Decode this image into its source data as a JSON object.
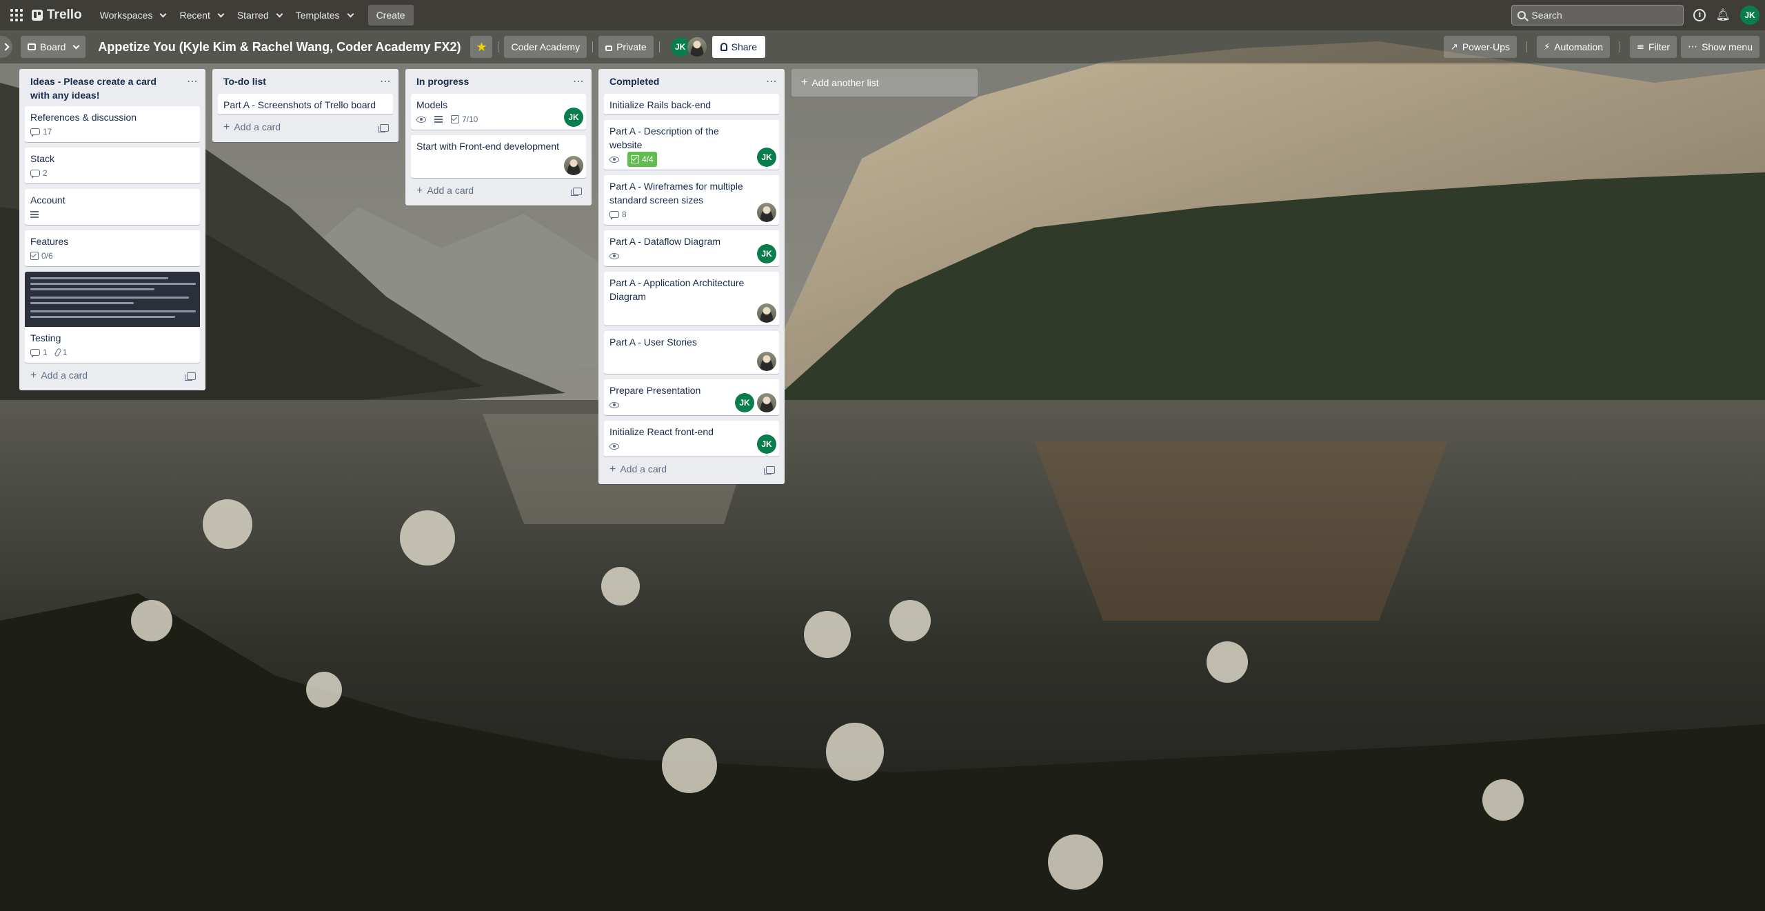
{
  "topnav": {
    "logo_text": "Trello",
    "menus": [
      "Workspaces",
      "Recent",
      "Starred",
      "Templates"
    ],
    "create_label": "Create",
    "search_placeholder": "Search",
    "user_initials": "JK"
  },
  "board": {
    "view_label": "Board",
    "title": "Appetize You (Kyle Kim & Rachel Wang, Coder Academy FX2)",
    "workspace_label": "Coder Academy",
    "visibility_label": "Private",
    "share_label": "Share",
    "powerups_label": "Power-Ups",
    "automation_label": "Automation",
    "filter_label": "Filter",
    "show_menu_label": "Show menu"
  },
  "colors": {
    "accent_green": "#0a7d4c",
    "done_green": "#61bd4f",
    "star_yellow": "#f2d600",
    "list_bg": "#ebecf0"
  },
  "lists": [
    {
      "title": "Ideas - Please create a card with any ideas!",
      "cards": [
        {
          "title": "References & discussion",
          "comments": "17"
        },
        {
          "title": "Stack",
          "comments": "2"
        },
        {
          "title": "Account",
          "has_description": true
        },
        {
          "title": "Features",
          "checklist": "0/6"
        },
        {
          "title": "Testing",
          "comments": "1",
          "attachments": "1",
          "has_cover": true
        }
      ],
      "add_card_label": "Add a card"
    },
    {
      "title": "To-do list",
      "cards": [
        {
          "title": "Part A - Screenshots of Trello board"
        }
      ],
      "add_card_label": "Add a card"
    },
    {
      "title": "In progress",
      "cards": [
        {
          "title": "Models",
          "watching": true,
          "has_description": true,
          "checklist": "7/10",
          "members": [
            "JK"
          ]
        },
        {
          "title": "Start with Front-end development",
          "members": [
            "photo"
          ]
        }
      ],
      "add_card_label": "Add a card"
    },
    {
      "title": "Completed",
      "cards": [
        {
          "title": "Initialize Rails back-end"
        },
        {
          "title": "Part A - Description of the website",
          "watching": true,
          "checklist_done": "4/4",
          "members": [
            "JK"
          ]
        },
        {
          "title": "Part A - Wireframes for multiple standard screen sizes",
          "comments": "8",
          "members": [
            "photo"
          ]
        },
        {
          "title": "Part A - Dataflow Diagram",
          "watching": true,
          "members": [
            "JK"
          ]
        },
        {
          "title": "Part A - Application Architecture Diagram",
          "members": [
            "photo"
          ]
        },
        {
          "title": "Part A - User Stories",
          "members": [
            "photo"
          ]
        },
        {
          "title": "Prepare Presentation",
          "watching": true,
          "members": [
            "JK",
            "photo"
          ]
        },
        {
          "title": "Initialize React front-end",
          "watching": true,
          "members": [
            "JK"
          ]
        }
      ],
      "add_card_label": "Add a card"
    }
  ],
  "add_list_label": "Add another list"
}
